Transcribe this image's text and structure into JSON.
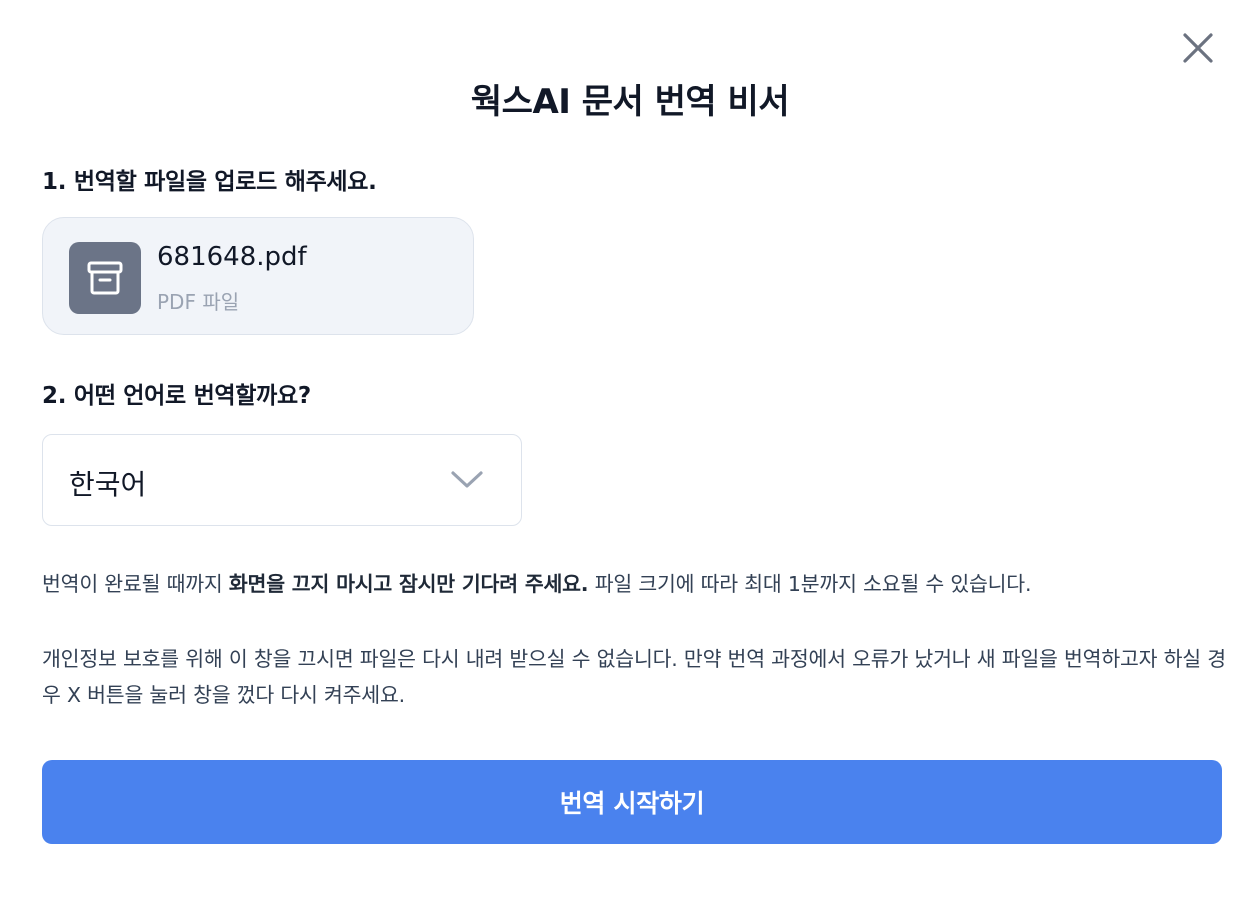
{
  "dialog": {
    "title": "웍스AI 문서 번역 비서",
    "close_icon": "close-icon"
  },
  "upload": {
    "label": "1. 번역할 파일을 업로드 해주세요.",
    "file_name": "681648.pdf",
    "file_type": "PDF 파일",
    "file_icon": "archive-icon"
  },
  "language": {
    "label": "2. 어떤 언어로 번역할까요?",
    "selected": "한국어",
    "icon": "chevron-down-icon"
  },
  "notices": {
    "wait_prefix": "번역이 완료될 때까지 ",
    "wait_bold": "화면을 끄지 마시고 잠시만 기다려 주세요.",
    "wait_suffix": " 파일 크기에 따라 최대 1분까지 소요될 수 있습니다.",
    "privacy": "개인정보 보호를 위해 이 창을 끄시면 파일은 다시 내려 받으실 수 없습니다. 만약 번역 과정에서 오류가 났거나 새 파일을 번역하고자 하실 경우 X 버튼을 눌러 창을 껐다 다시 켜주세요."
  },
  "actions": {
    "start_label": "번역 시작하기"
  },
  "colors": {
    "primary": "#4a82ee",
    "file_icon_bg": "#6b7487",
    "card_bg": "#f1f4f9"
  }
}
